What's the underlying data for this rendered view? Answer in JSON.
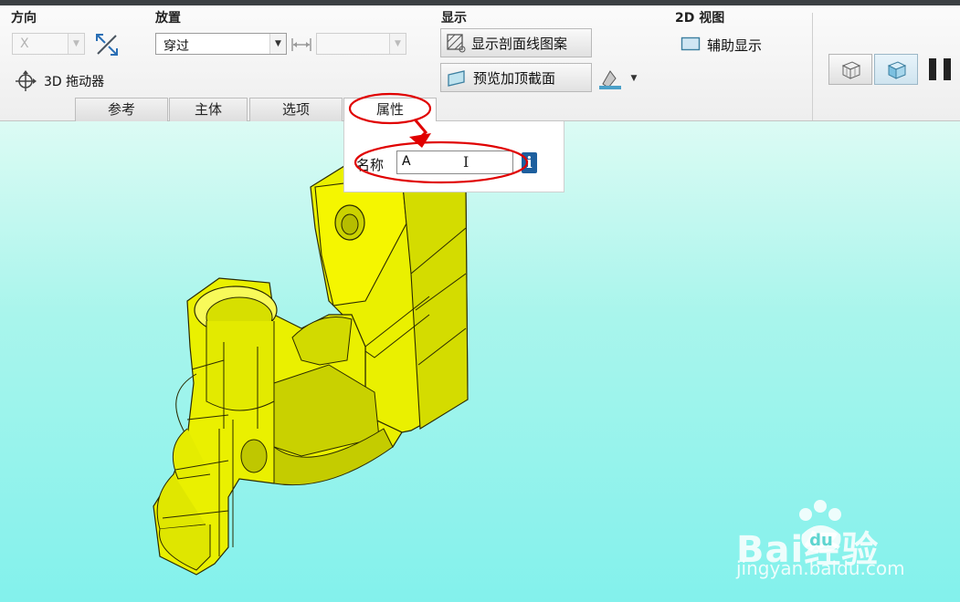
{
  "ribbon": {
    "groups": {
      "direction": "方向",
      "placement": "放置",
      "display": "显示",
      "view2d": "2D 视图"
    },
    "direction_axis": "X",
    "placement_type": "穿过",
    "placement_offset": "",
    "dragger_label": "3D 拖动器",
    "show_hatch_label": "显示剖面线图案",
    "preview_cap_label": "预览加顶截面",
    "aux_display_label": "辅助显示"
  },
  "tabs": [
    {
      "label": "参考",
      "active": false
    },
    {
      "label": "主体",
      "active": false
    },
    {
      "label": "选项",
      "active": false
    },
    {
      "label": "属性",
      "active": true
    }
  ],
  "properties": {
    "name_label": "名称",
    "name_value": "A",
    "info_icon": "i"
  },
  "watermark": {
    "brand": "Bai经验",
    "brand_du": "du",
    "url": "jingyan.baidu.com"
  },
  "colors": {
    "model_yellow": "#eaf000",
    "annotation_red": "#e00000",
    "viewport_cyan": "#83f1ec"
  }
}
